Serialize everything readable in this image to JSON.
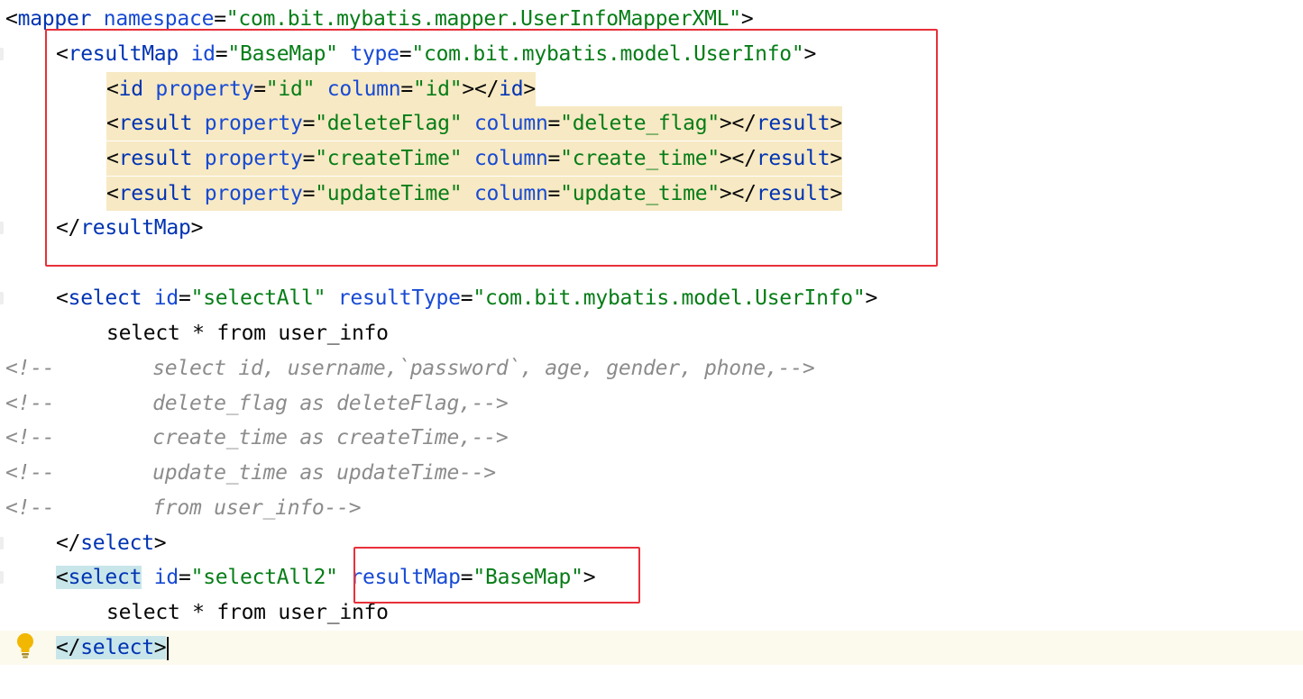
{
  "editor": {
    "lines": [
      {
        "id": "mapper-open",
        "tokens": [
          {
            "t": "<",
            "c": "punct"
          },
          {
            "t": "mapper",
            "c": "tag"
          },
          {
            "t": " namespace",
            "c": "attr"
          },
          {
            "t": "=",
            "c": "punct"
          },
          {
            "t": "\"com.bit.mybatis.mapper.UserInfoMapperXML\"",
            "c": "str"
          },
          {
            "t": ">",
            "c": "punct"
          }
        ]
      },
      {
        "id": "resultmap-open",
        "tokens": [
          {
            "t": "<",
            "c": "punct"
          },
          {
            "t": "resultMap",
            "c": "tag"
          },
          {
            "t": " id",
            "c": "attr"
          },
          {
            "t": "=",
            "c": "punct"
          },
          {
            "t": "\"BaseMap\"",
            "c": "str"
          },
          {
            "t": " type",
            "c": "attr"
          },
          {
            "t": "=",
            "c": "punct"
          },
          {
            "t": "\"com.bit.mybatis.model.UserInfo\"",
            "c": "str"
          },
          {
            "t": ">",
            "c": "punct"
          }
        ]
      },
      {
        "id": "id-element",
        "tokens": [
          {
            "t": "<",
            "c": "punct"
          },
          {
            "t": "id",
            "c": "tag"
          },
          {
            "t": " property",
            "c": "attr"
          },
          {
            "t": "=",
            "c": "punct"
          },
          {
            "t": "\"id\"",
            "c": "str"
          },
          {
            "t": " column",
            "c": "attr"
          },
          {
            "t": "=",
            "c": "punct"
          },
          {
            "t": "\"id\"",
            "c": "str"
          },
          {
            "t": "></",
            "c": "punct"
          },
          {
            "t": "id",
            "c": "tag"
          },
          {
            "t": ">",
            "c": "punct"
          }
        ]
      },
      {
        "id": "result-deleteflag",
        "tokens": [
          {
            "t": "<",
            "c": "punct"
          },
          {
            "t": "result",
            "c": "tag"
          },
          {
            "t": " property",
            "c": "attr"
          },
          {
            "t": "=",
            "c": "punct"
          },
          {
            "t": "\"deleteFlag\"",
            "c": "str"
          },
          {
            "t": " column",
            "c": "attr"
          },
          {
            "t": "=",
            "c": "punct"
          },
          {
            "t": "\"delete_flag\"",
            "c": "str"
          },
          {
            "t": "></",
            "c": "punct"
          },
          {
            "t": "result",
            "c": "tag"
          },
          {
            "t": ">",
            "c": "punct"
          }
        ]
      },
      {
        "id": "result-createtime",
        "tokens": [
          {
            "t": "<",
            "c": "punct"
          },
          {
            "t": "result",
            "c": "tag"
          },
          {
            "t": " property",
            "c": "attr"
          },
          {
            "t": "=",
            "c": "punct"
          },
          {
            "t": "\"createTime\"",
            "c": "str"
          },
          {
            "t": " column",
            "c": "attr"
          },
          {
            "t": "=",
            "c": "punct"
          },
          {
            "t": "\"create_time\"",
            "c": "str"
          },
          {
            "t": "></",
            "c": "punct"
          },
          {
            "t": "result",
            "c": "tag"
          },
          {
            "t": ">",
            "c": "punct"
          }
        ]
      },
      {
        "id": "result-updatetime",
        "tokens": [
          {
            "t": "<",
            "c": "punct"
          },
          {
            "t": "result",
            "c": "tag"
          },
          {
            "t": " property",
            "c": "attr"
          },
          {
            "t": "=",
            "c": "punct"
          },
          {
            "t": "\"updateTime\"",
            "c": "str"
          },
          {
            "t": " column",
            "c": "attr"
          },
          {
            "t": "=",
            "c": "punct"
          },
          {
            "t": "\"update_time\"",
            "c": "str"
          },
          {
            "t": "></",
            "c": "punct"
          },
          {
            "t": "result",
            "c": "tag"
          },
          {
            "t": ">",
            "c": "punct"
          }
        ]
      },
      {
        "id": "resultmap-close",
        "tokens": [
          {
            "t": "</",
            "c": "punct"
          },
          {
            "t": "resultMap",
            "c": "tag"
          },
          {
            "t": ">",
            "c": "punct"
          }
        ]
      },
      {
        "id": "blank",
        "tokens": []
      },
      {
        "id": "select-all-open",
        "tokens": [
          {
            "t": "<",
            "c": "punct"
          },
          {
            "t": "select",
            "c": "tag"
          },
          {
            "t": " id",
            "c": "attr"
          },
          {
            "t": "=",
            "c": "punct"
          },
          {
            "t": "\"selectAll\"",
            "c": "str"
          },
          {
            "t": " resultType",
            "c": "attr"
          },
          {
            "t": "=",
            "c": "punct"
          },
          {
            "t": "\"com.bit.mybatis.model.UserInfo\"",
            "c": "str"
          },
          {
            "t": ">",
            "c": "punct"
          }
        ]
      },
      {
        "id": "select-all-sql",
        "tokens": [
          {
            "t": "select * from user_info",
            "c": "punct"
          }
        ]
      },
      {
        "id": "comment-1",
        "tokens": [
          {
            "t": "<!--        select id, username,`password`, age, gender, phone,-->",
            "c": "cmt"
          }
        ]
      },
      {
        "id": "comment-2",
        "tokens": [
          {
            "t": "<!--        delete_flag as deleteFlag,-->",
            "c": "cmt"
          }
        ]
      },
      {
        "id": "comment-3",
        "tokens": [
          {
            "t": "<!--        create_time as createTime,-->",
            "c": "cmt"
          }
        ]
      },
      {
        "id": "comment-4",
        "tokens": [
          {
            "t": "<!--        update_time as updateTime-->",
            "c": "cmt"
          }
        ]
      },
      {
        "id": "comment-5",
        "tokens": [
          {
            "t": "<!--        from user_info-->",
            "c": "cmt"
          }
        ]
      },
      {
        "id": "select-all-close",
        "tokens": [
          {
            "t": "</",
            "c": "punct"
          },
          {
            "t": "select",
            "c": "tag"
          },
          {
            "t": ">",
            "c": "punct"
          }
        ]
      },
      {
        "id": "select-all2-open",
        "tokens": [
          {
            "t": "<",
            "c": "punct"
          },
          {
            "t": "select",
            "c": "tag"
          },
          {
            "t": " id",
            "c": "attr"
          },
          {
            "t": "=",
            "c": "punct"
          },
          {
            "t": "\"selectAll2\"",
            "c": "str"
          },
          {
            "t": " resultMap",
            "c": "attr"
          },
          {
            "t": "=",
            "c": "punct"
          },
          {
            "t": "\"BaseMap\"",
            "c": "str"
          },
          {
            "t": ">",
            "c": "punct"
          }
        ]
      },
      {
        "id": "select-all2-sql",
        "tokens": [
          {
            "t": "select * from user_info",
            "c": "punct"
          }
        ]
      },
      {
        "id": "select-all2-close",
        "tokens": [
          {
            "t": "</",
            "c": "punct"
          },
          {
            "t": "select",
            "c": "tag"
          },
          {
            "t": ">",
            "c": "punct"
          }
        ]
      }
    ]
  },
  "colors": {
    "tag": "#0033b3",
    "attribute": "#174ad4",
    "string": "#067d17",
    "comment": "#8c8c8c",
    "highlight_yellow": "#f7e9c3",
    "highlight_teal": "#c8e6ea",
    "annotation_box": "#e8303a"
  },
  "icons": {
    "intention": "lightbulb-icon"
  }
}
